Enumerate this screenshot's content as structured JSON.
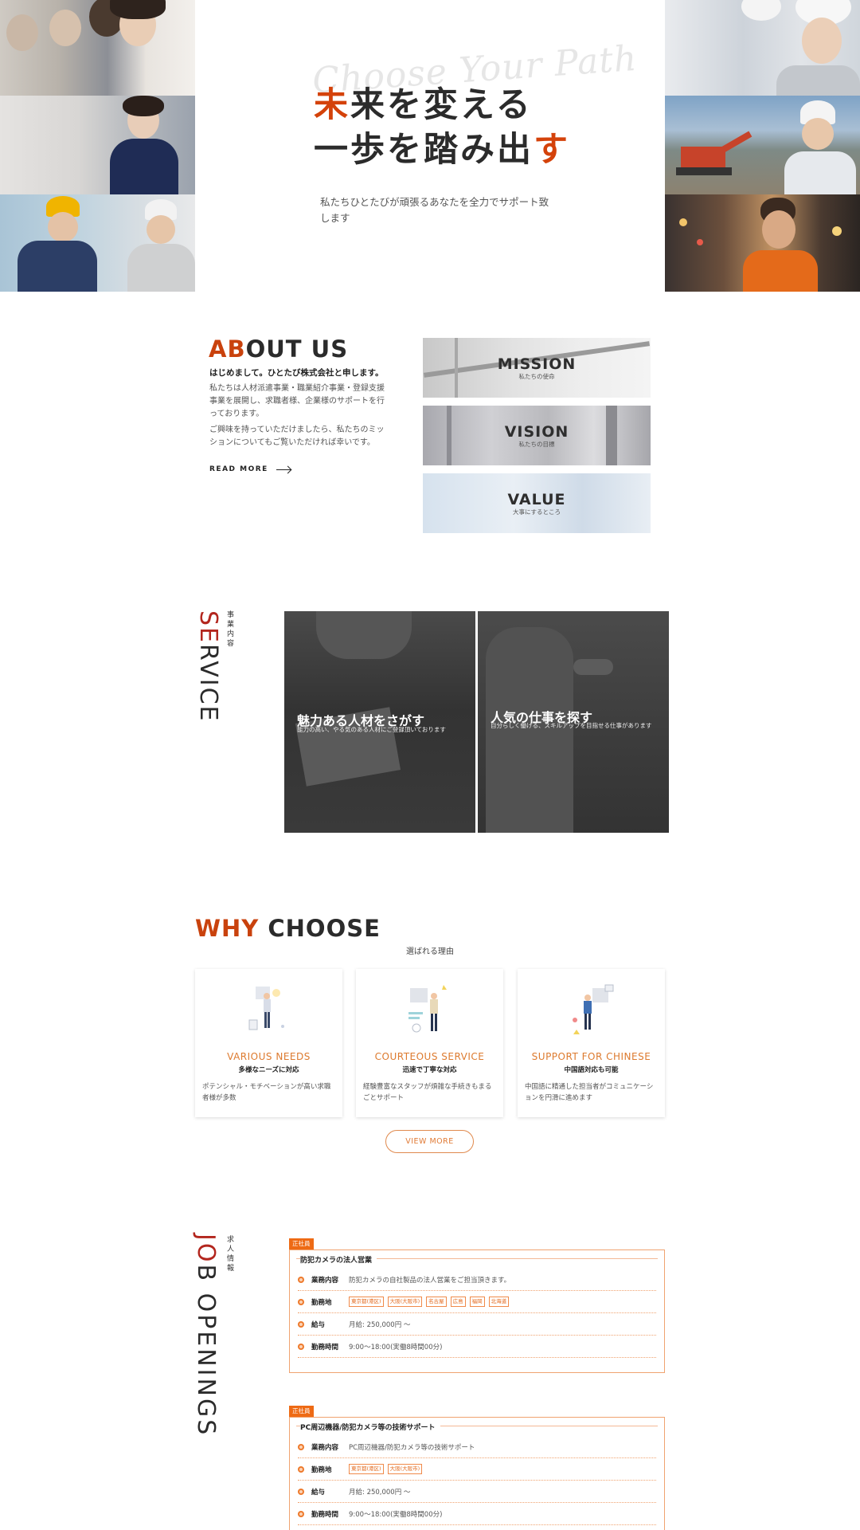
{
  "hero": {
    "script_text": "Choose Your Path",
    "title_line1_accent": "未",
    "title_line1_rest": "来を変える",
    "title_line2_rest": "一歩を踏み出",
    "title_line2_accent": "す",
    "subtitle": "私たちひとたびが頑張るあなたを全力でサポート致します"
  },
  "about": {
    "title_accent": "AB",
    "title_rest": "OUT US",
    "lead": "はじめまして。ひとたび株式会社と申します。",
    "paragraph1": "私たちは人材派遣事業・職業紹介事業・登録支援事業を展開し、求職者様、企業様のサポートを行っております。",
    "paragraph2": "ご興味を持っていただけましたら、私たちのミッションについてもご覧いただければ幸いです。",
    "read_more": "READ MORE",
    "panels": [
      {
        "title": "MISSION",
        "sub": "私たちの使命"
      },
      {
        "title": "VISION",
        "sub": "私たちの目標"
      },
      {
        "title": "VALUE",
        "sub": "大事にするところ"
      }
    ]
  },
  "service": {
    "title": "SERVICE",
    "title_accent": "SE",
    "title_rest": "RVICE",
    "jp_label": "事業内容",
    "cards": [
      {
        "heading": "魅力ある人材をさがす",
        "desc": "能力の高い、やる気のある人材にご登録頂いております"
      },
      {
        "heading": "人気の仕事を探す",
        "desc": "自分らしく働ける、スキルアップを目指せる仕事があります"
      }
    ]
  },
  "why": {
    "title_accent": "WHY",
    "title_rest": " CHOOSE",
    "subtitle": "選ばれる理由",
    "cards": [
      {
        "en": "VARIOUS NEEDS",
        "jp": "多様なニーズに対応",
        "desc": "ポテンシャル・モチベーションが高い求職者様が多数"
      },
      {
        "en": "COURTEOUS SERVICE",
        "jp": "迅速で丁寧な対応",
        "desc": "経験豊富なスタッフが煩雑な手続きもまるごとサポート"
      },
      {
        "en": "SUPPORT FOR CHINESE",
        "jp": "中国語対応も可能",
        "desc": "中国語に精通した担当者がコミュニケーションを円滑に進めます"
      }
    ],
    "view_more": "VIEW MORE"
  },
  "jobs": {
    "title_accent": "JO",
    "title_rest": "B OPENINGS",
    "jp_label": "求人情報",
    "labels": {
      "work": "業務内容",
      "location": "勤務地",
      "salary": "給与",
      "hours": "勤務時間"
    },
    "list": [
      {
        "badge": "正社員",
        "title": "防犯カメラの法人営業",
        "work": "防犯カメラの自社製品の法人営業をご担当頂きます。",
        "locations": [
          "東京都(港区)",
          "大阪(大阪市)",
          "名古屋",
          "広島",
          "福岡",
          "北海道"
        ],
        "salary": "月給: 250,000円 〜",
        "hours": "9:00〜18:00(実働8時間00分)"
      },
      {
        "badge": "正社員",
        "title": "PC周辺機器/防犯カメラ等の技術サポート",
        "work": "PC周辺機器/防犯カメラ等の技術サポート",
        "locations": [
          "東京都(港区)",
          "大阪(大阪市)"
        ],
        "salary": "月給: 250,000円 〜",
        "hours": "9:00〜18:00(実働8時間00分)"
      }
    ]
  }
}
